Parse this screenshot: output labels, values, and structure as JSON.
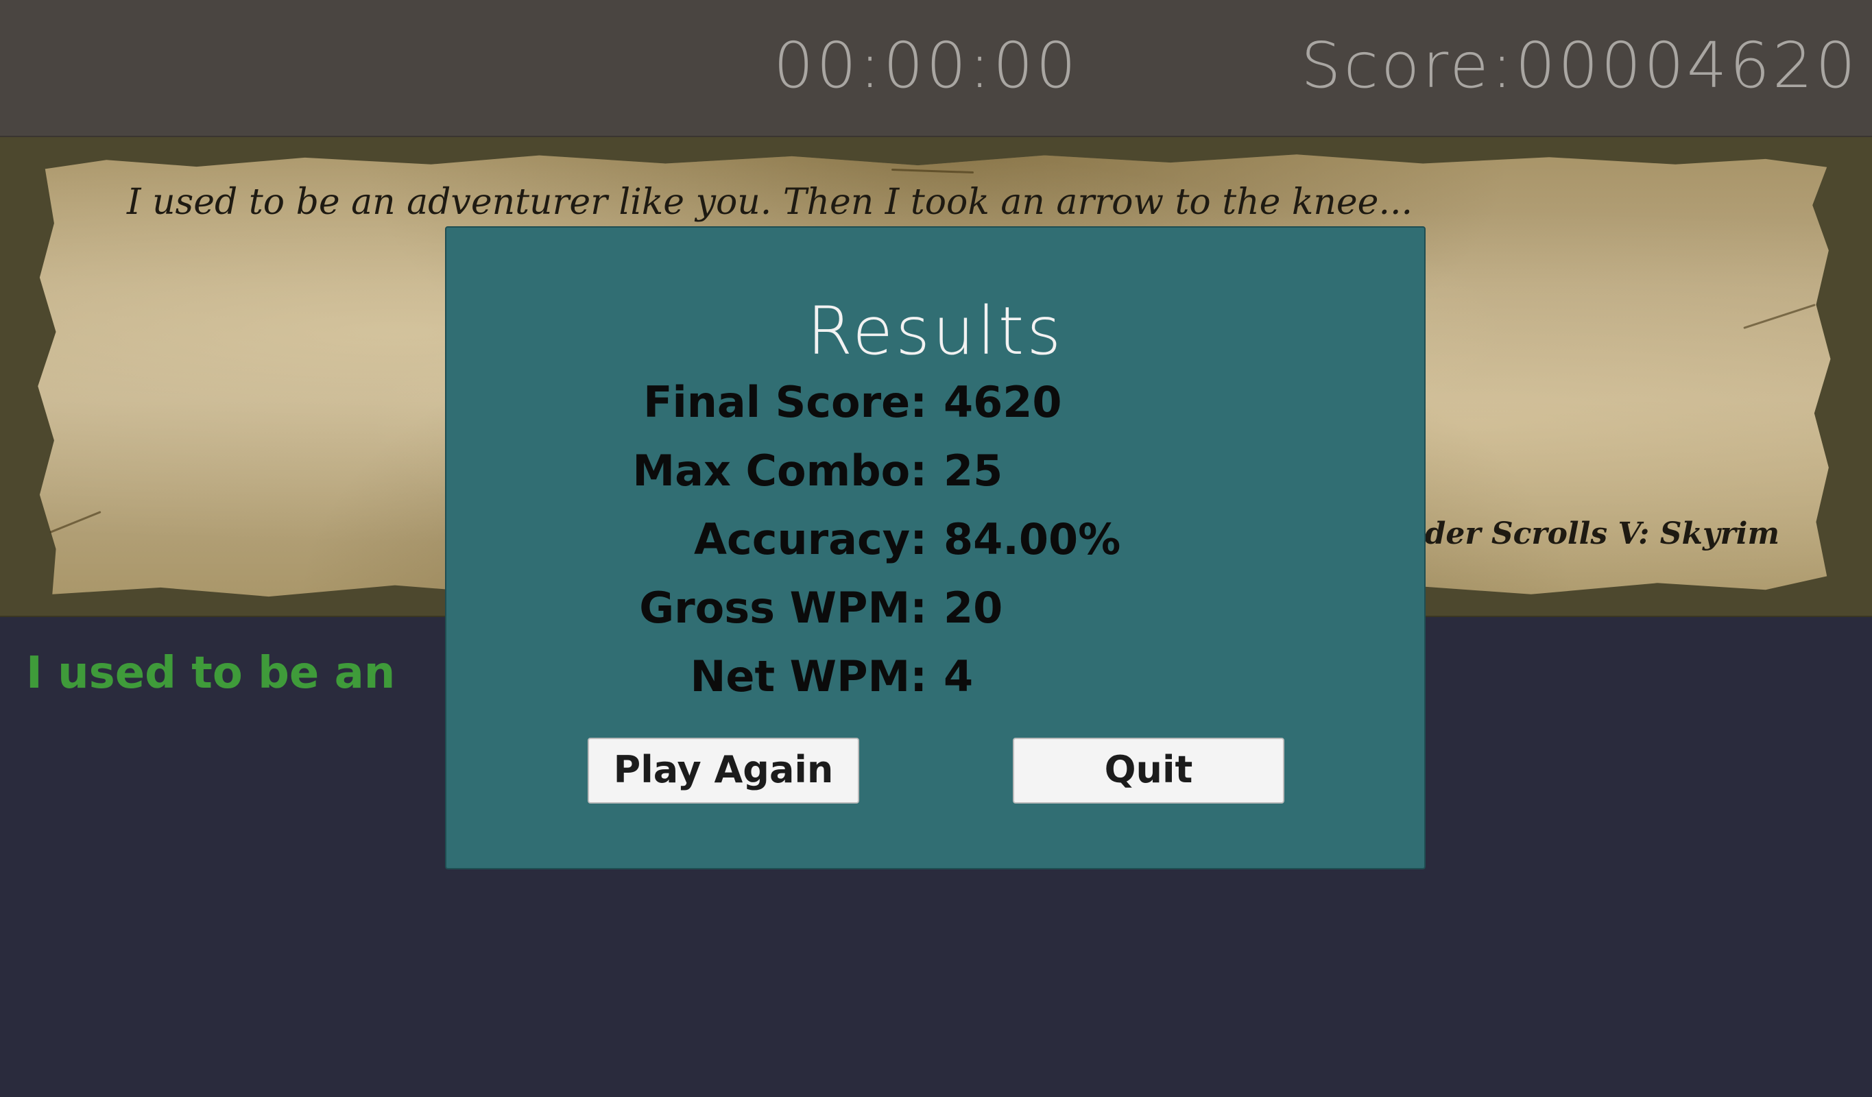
{
  "header": {
    "timer": "00:00:00",
    "score": "Score:00004620"
  },
  "quote": {
    "text": "I used to be an adventurer like you. Then I took an arrow to the knee...",
    "source": "Elder Scrolls V: Skyrim"
  },
  "typed": {
    "text": "I used to be an"
  },
  "results": {
    "title": "Results",
    "stats": [
      {
        "label": "Final Score:",
        "value": "4620"
      },
      {
        "label": "Max Combo:",
        "value": "25"
      },
      {
        "label": "Accuracy:",
        "value": "84.00%"
      },
      {
        "label": "Gross WPM:",
        "value": "20"
      },
      {
        "label": "Net WPM:",
        "value": "4"
      }
    ],
    "play_again_label": "Play Again",
    "quit_label": "Quit"
  },
  "colors": {
    "header_bg": "#4a4541",
    "modal_bg": "#316e73",
    "typed_text": "#3f9b3a",
    "page_bg": "#2a2b3d"
  }
}
